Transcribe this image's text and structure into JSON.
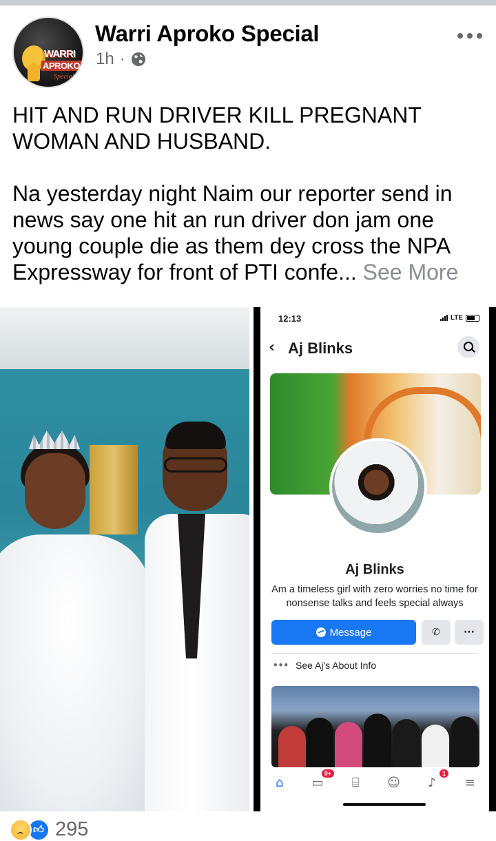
{
  "post": {
    "author": "Warri Aproko Special",
    "avatar_text": [
      "WARRI",
      "APROKO",
      "Special"
    ],
    "time": "1h",
    "separator": "·",
    "title": "HIT AND RUN DRIVER KILL PREGNANT WOMAN AND HUSBAND.",
    "body": "Na yesterday night Naim our reporter send in news say one hit an run driver don jam one young couple die as them dey cross the NPA Expressway for front of PTI confe...",
    "see_more": "See More"
  },
  "screenshot": {
    "status_time": "12:13",
    "network": "LTE",
    "header_title": "Aj Blinks",
    "profile_name": "Aj Blinks",
    "bio": "Am a timeless girl with zero worries no time for nonsense talks and feels special always",
    "message_label": "Message",
    "about_label": "See Aj's About Info",
    "notifications_badge": "9+",
    "alerts_badge": "1"
  },
  "reactions": {
    "count": "295"
  },
  "colors": {
    "brand_blue": "#1877f2",
    "muted": "#65676b",
    "badge_red": "#e41e3f"
  }
}
